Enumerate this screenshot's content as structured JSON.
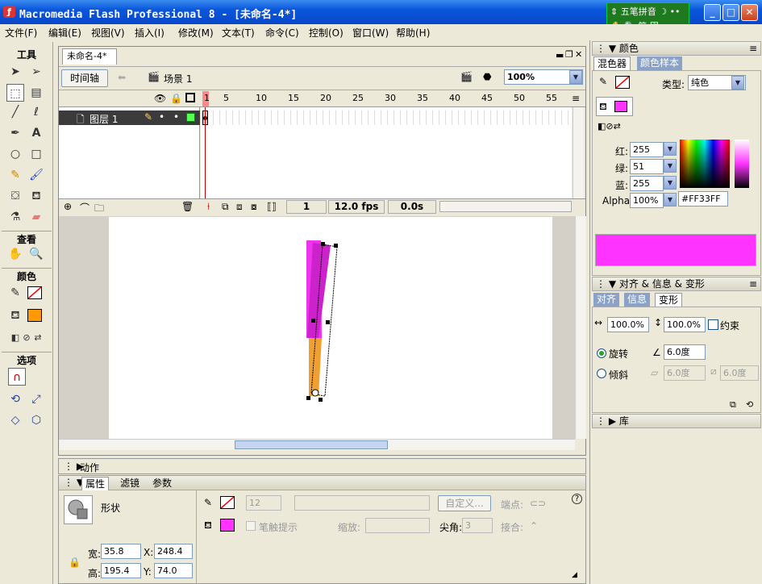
{
  "window": {
    "title": "Macromedia Flash Professional 8 - [未命名-4*]",
    "min": "_",
    "max": "□",
    "close": "✕"
  },
  "ime": {
    "label": "五笔拼音",
    "sub": "简 図"
  },
  "menu": [
    {
      "label": "文件(F)"
    },
    {
      "label": "编辑(E)"
    },
    {
      "label": "视图(V)"
    },
    {
      "label": "插入(I)"
    },
    {
      "label": "修改(M)"
    },
    {
      "label": "文本(T)"
    },
    {
      "label": "命令(C)"
    },
    {
      "label": "控制(O)"
    },
    {
      "label": "窗口(W)"
    },
    {
      "label": "帮助(H)"
    }
  ],
  "toolbox": {
    "title": "工具",
    "view": "查看",
    "colors": "颜色",
    "options": "选项",
    "stroke_color": "#000000",
    "fill_color": "#FF9900"
  },
  "doc": {
    "tab": "未命名-4*",
    "timeline_btn": "时间轴",
    "scene": "场景 1",
    "zoom": "100%",
    "frame_numbers": [
      "1",
      "5",
      "10",
      "15",
      "20",
      "25",
      "30",
      "35",
      "40",
      "45",
      "50",
      "55"
    ],
    "layer": "图层 1",
    "cur_frame": "1",
    "fps": "12.0 fps",
    "time": "0.0s"
  },
  "panels": {
    "actions": "动作",
    "props": {
      "tabs": [
        "属性",
        "滤镜",
        "参数"
      ],
      "type": "形状",
      "stroke_size": "12",
      "custom_btn": "自定义...",
      "endpoint": "端点:",
      "hint": "笔触提示",
      "scale": "缩放:",
      "miter": "尖角:",
      "miter_val": "3",
      "join": "接合:",
      "w_label": "宽:",
      "w_val": "35.8",
      "x_label": "X:",
      "x_val": "248.4",
      "h_label": "高:",
      "h_val": "195.4",
      "y_label": "Y:",
      "y_val": "74.0",
      "fill_color": "#FF33FF"
    },
    "color": {
      "title": "颜色",
      "tabs": [
        "混色器",
        "颜色样本"
      ],
      "type_label": "类型:",
      "type_val": "纯色",
      "r_label": "红:",
      "r": "255",
      "g_label": "绿:",
      "g": "51",
      "b_label": "蓝:",
      "b": "255",
      "alpha_label": "Alpha:",
      "alpha": "100%",
      "hex": "#FF33FF",
      "swatch": "#FF33FF"
    },
    "transform": {
      "title": "对齐 & 信息 & 变形",
      "tabs": [
        "对齐",
        "信息",
        "变形"
      ],
      "w_pct": "100.0%",
      "h_pct": "100.0%",
      "constrain": "约束",
      "rotate_label": "旋转",
      "rotate_val": "6.0度",
      "skew_label": "倾斜",
      "skew_h": "6.0度",
      "skew_v": "6.0度"
    },
    "library": "库"
  }
}
